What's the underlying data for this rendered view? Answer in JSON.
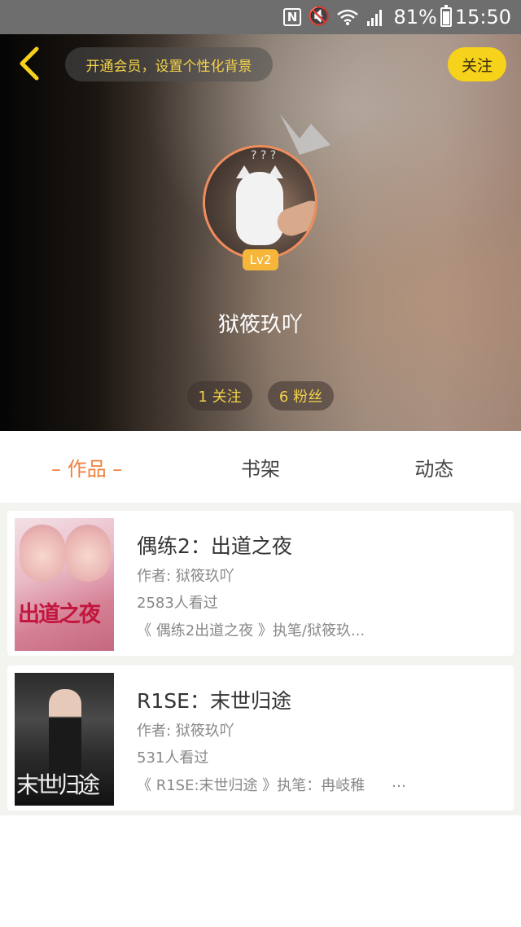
{
  "status_bar": {
    "nfc": "N",
    "battery": "81%",
    "time": "15:50"
  },
  "header": {
    "vip_prompt": "开通会员，设置个性化背景",
    "follow_label": "关注",
    "level_badge": "Lv2",
    "avatar_qmarks": "? ? ?",
    "username": "狱筱玖吖",
    "following": "1 关注",
    "fans": "6 粉丝"
  },
  "tabs": [
    {
      "label": "作品",
      "active": true
    },
    {
      "label": "书架",
      "active": false
    },
    {
      "label": "动态",
      "active": false
    }
  ],
  "books": [
    {
      "title": "偶练2：出道之夜",
      "author": "作者: 狱筱玖吖",
      "views": "2583人看过",
      "description": "《 偶练2出道之夜 》执笔/狱筱玖...",
      "more": "",
      "cover_text": "出道之夜"
    },
    {
      "title": "R1SE：末世归途",
      "author": "作者: 狱筱玖吖",
      "views": "531人看过",
      "description": "《 R1SE:末世归途 》执笔：冉岐稚",
      "more": "…",
      "cover_text": "末世归途"
    }
  ],
  "colors": {
    "accent": "#ef7f3c",
    "follow_button": "#f7d21a",
    "gold_text": "#f4d24a",
    "avatar_ring": "#ef8d5c"
  }
}
